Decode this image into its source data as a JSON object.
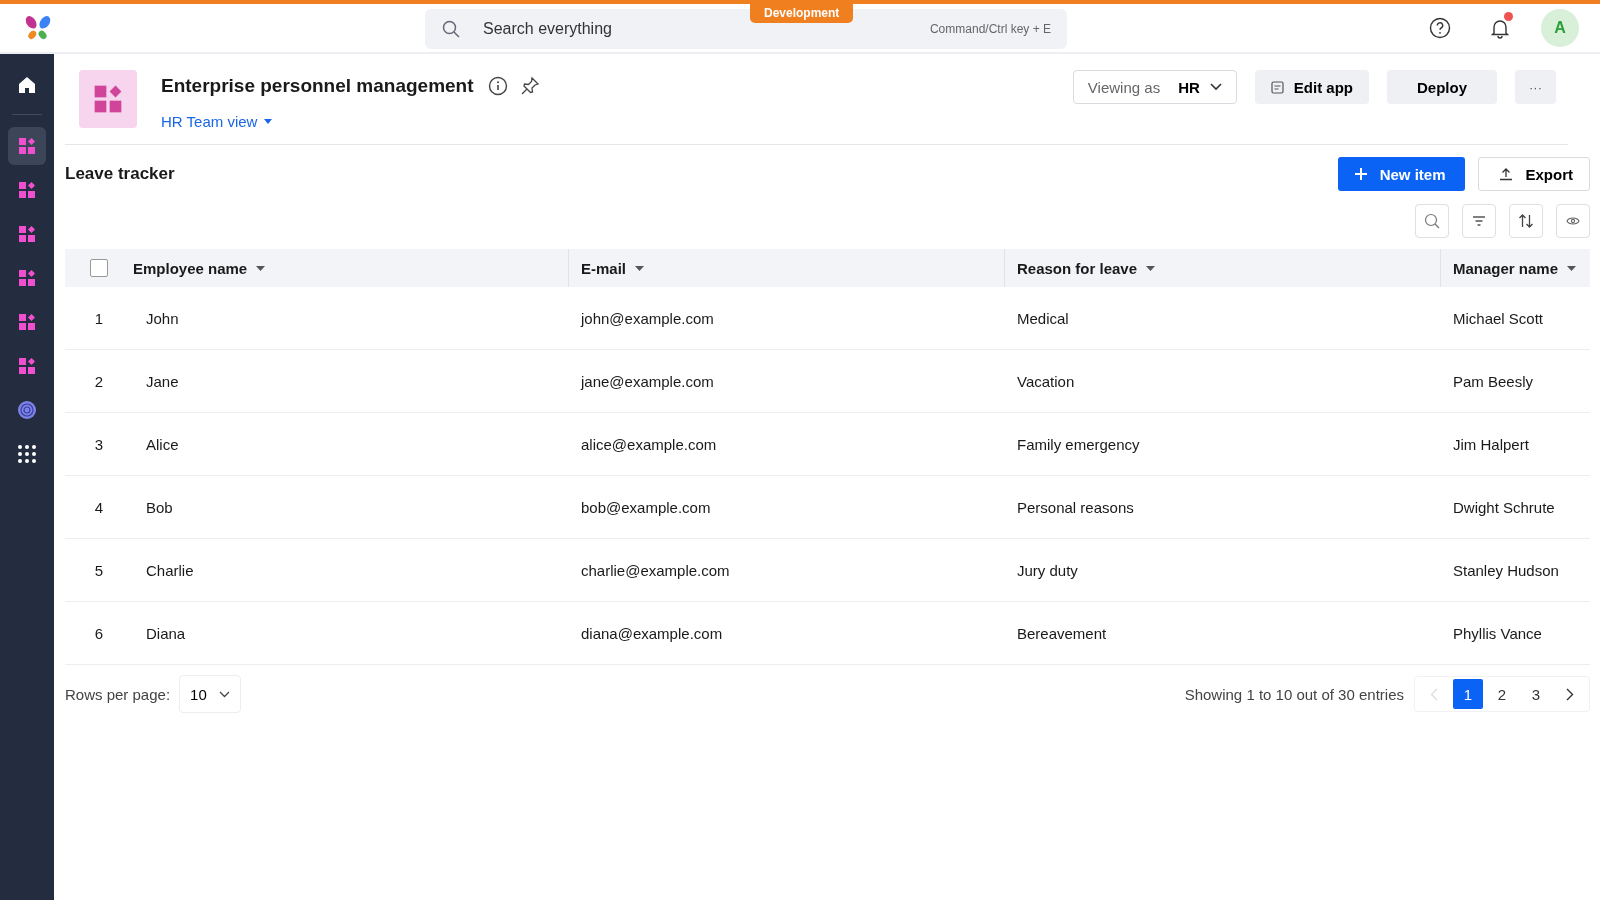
{
  "top_bar": {
    "search": {
      "placeholder": "Search everything",
      "shortcut": "Command/Ctrl key + E"
    },
    "environment_badge": "Development",
    "notifications": {
      "unread": true
    },
    "avatar": "A"
  },
  "sidebar": {
    "items": [
      {
        "kind": "home",
        "selected": false
      },
      {
        "kind": "app",
        "selected": true
      },
      {
        "kind": "app",
        "selected": false
      },
      {
        "kind": "app",
        "selected": false
      },
      {
        "kind": "app",
        "selected": false
      },
      {
        "kind": "app",
        "selected": false
      },
      {
        "kind": "app",
        "selected": false
      },
      {
        "kind": "target",
        "selected": false
      },
      {
        "kind": "grid",
        "selected": false
      }
    ]
  },
  "header": {
    "title": "Enterprise personnel management",
    "view": "HR Team view",
    "viewing_as": {
      "label": "Viewing as",
      "value": "HR"
    },
    "buttons": [
      "Edit app",
      "Deploy"
    ],
    "more": "···"
  },
  "section": {
    "title": "Leave tracker",
    "new_button": "New item",
    "export_button": "Export"
  },
  "table": {
    "select_all_checked": false,
    "columns": [
      "Employee name",
      "E-mail",
      "Reason for leave",
      "Manager name"
    ],
    "rows": [
      {
        "index": "1",
        "cells": [
          "John",
          "john@example.com",
          "Medical",
          "Michael Scott"
        ],
        "checked": false
      },
      {
        "index": "2",
        "cells": [
          "Jane",
          "jane@example.com",
          "Vacation",
          "Pam Beesly"
        ],
        "checked": false
      },
      {
        "index": "3",
        "cells": [
          "Alice",
          "alice@example.com",
          "Family emergency",
          "Jim Halpert"
        ],
        "checked": false
      },
      {
        "index": "4",
        "cells": [
          "Bob",
          "bob@example.com",
          "Personal reasons",
          "Dwight Schrute"
        ],
        "checked": false
      },
      {
        "index": "5",
        "cells": [
          "Charlie",
          "charlie@example.com",
          "Jury duty",
          "Stanley Hudson"
        ],
        "checked": false
      },
      {
        "index": "6",
        "cells": [
          "Diana",
          "diana@example.com",
          "Bereavement",
          "Phyllis Vance"
        ],
        "checked": false
      }
    ]
  },
  "footer": {
    "rows_per_page_label": "Rows per page:",
    "rows_per_page": "10",
    "summary": "Showing 1 to 10 out of 30 entries",
    "pages": [
      {
        "label": "1",
        "selected": true
      },
      {
        "label": "2",
        "selected": false
      },
      {
        "label": "3",
        "selected": false
      }
    ],
    "previous_disabled": true
  }
}
